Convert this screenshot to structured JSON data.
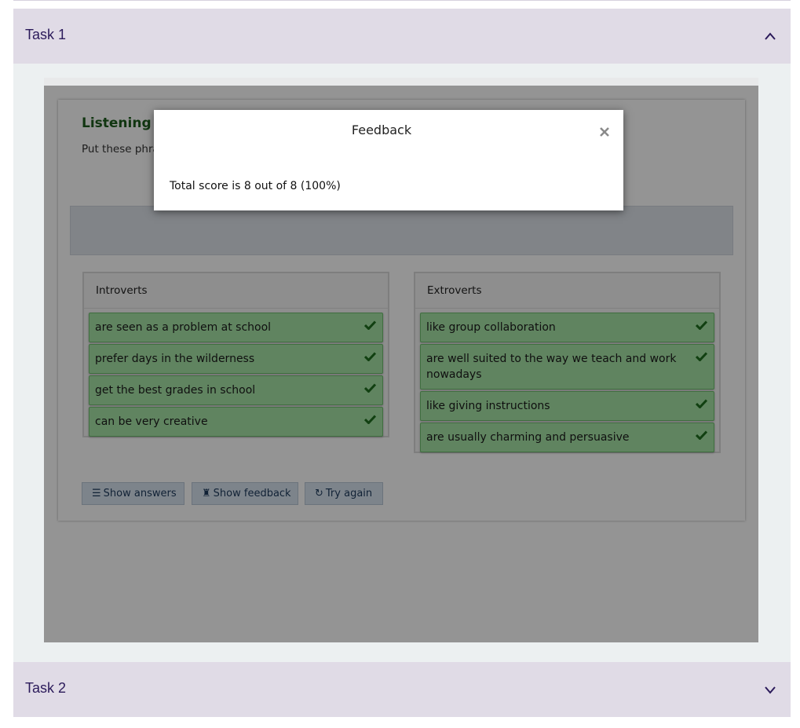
{
  "accordion": {
    "task1": {
      "title": "Task 1",
      "expanded": true
    },
    "task2": {
      "title": "Task 2",
      "expanded": false
    }
  },
  "activity": {
    "title": "Listening C1",
    "instruction": "Put these phrase",
    "dropzones": [
      {
        "label": "Introverts",
        "items": [
          "are seen as a problem at school",
          "prefer days in the wilderness",
          "get the best grades in school",
          "can be very creative"
        ]
      },
      {
        "label": "Extroverts",
        "items": [
          "like group collaboration",
          "are well suited to the way we teach and work nowadays",
          "like giving instructions",
          "are usually charming and persuasive"
        ]
      }
    ],
    "buttons": {
      "show_answers": "Show answers",
      "show_feedback": "Show feedback",
      "try_again": "Try again"
    }
  },
  "feedback_dialog": {
    "title": "Feedback",
    "score_text": "Total score is 8 out of 8 (100%)"
  },
  "colors": {
    "accordion_header": "#e0dbe6",
    "accordion_title": "#2b1a5a",
    "correct_item": "#a6e3a6",
    "check": "#1e6e1e",
    "title_green": "#1e5e1e"
  },
  "icons": {
    "chevron_up": "chevron-up-icon",
    "chevron_down": "chevron-down-icon",
    "check": "check-icon",
    "close": "close-icon",
    "list": "list-icon",
    "feedback": "feedback-icon",
    "refresh": "refresh-icon"
  }
}
